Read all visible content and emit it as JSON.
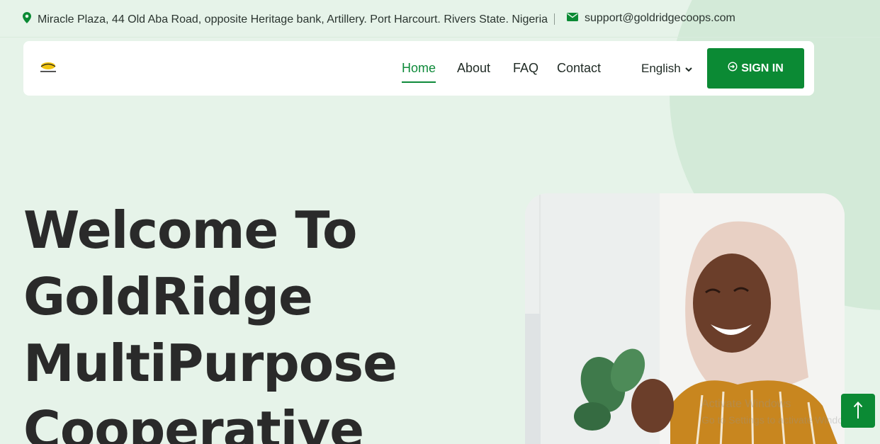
{
  "topbar": {
    "address": "Miracle Plaza, 44 Old Aba Road, opposite Heritage bank, Artillery. Port Harcourt. Rivers State. Nigeria",
    "email": "support@goldridgecoops.com",
    "address_icon": "map-pin-icon",
    "email_icon": "envelope-icon"
  },
  "nav": {
    "links": [
      "Home",
      "About",
      "FAQ",
      "Contact"
    ],
    "active": "Home",
    "language": "English",
    "signin_label": "SIGN IN",
    "signin_icon": "sign-in-icon"
  },
  "hero": {
    "title_lines": [
      "Welcome To",
      "GoldRidge",
      "MultiPurpose",
      "Cooperative"
    ]
  },
  "watermark": {
    "line1": "Activate Windows",
    "line2": "Go to Settings to activate Windows."
  },
  "colors": {
    "brand_green": "#0b8a34",
    "page_bg": "#e6f3e9",
    "heading": "#2a2a2a"
  }
}
